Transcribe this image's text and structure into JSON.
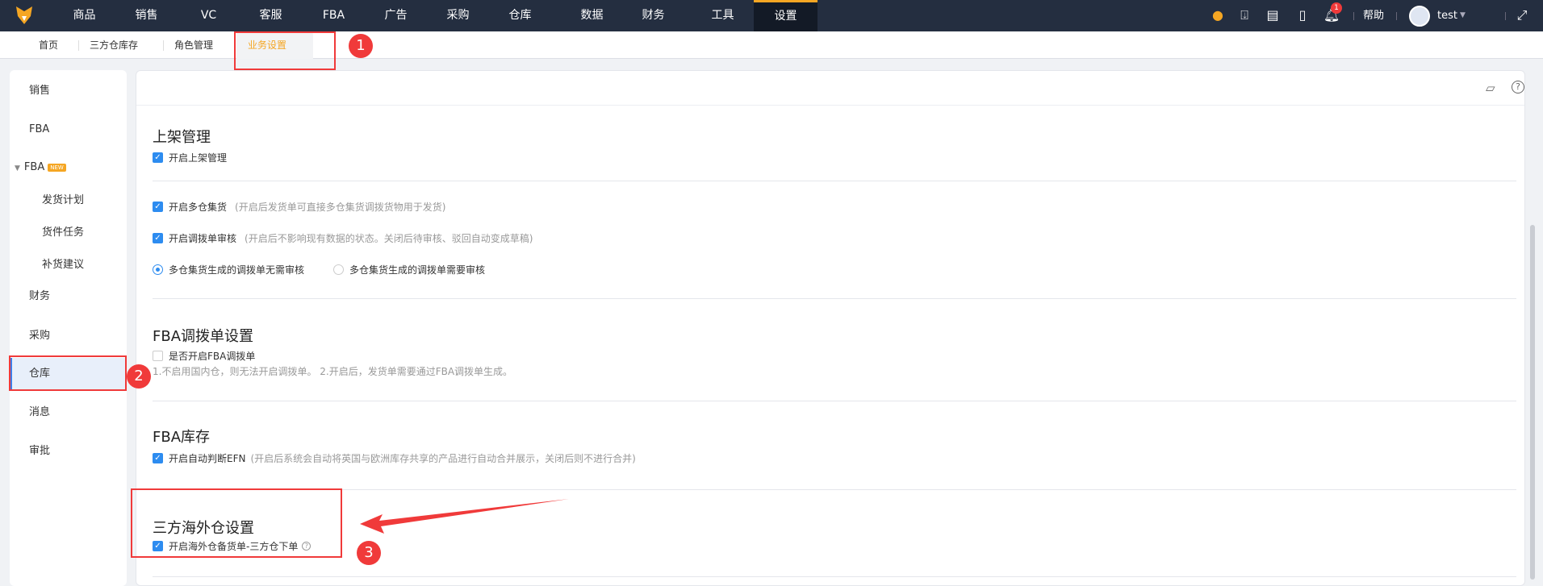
{
  "nav": {
    "items": [
      "商品",
      "销售",
      "VC",
      "客服",
      "FBA",
      "广告",
      "采购",
      "仓库",
      "数据",
      "财务",
      "工具",
      "设置"
    ],
    "active": "设置",
    "help": "帮助",
    "user": "test",
    "notification_count": "1"
  },
  "tabs": {
    "items": [
      "首页",
      "三方仓库存",
      "角色管理"
    ],
    "active": "业务设置",
    "close": "×"
  },
  "sidebar": {
    "items": [
      "销售",
      "FBA",
      "FBA",
      "发货计划",
      "货件任务",
      "补货建议",
      "财务",
      "采购",
      "仓库",
      "消息",
      "审批"
    ],
    "new_badge": "NEW"
  },
  "main": {
    "s1": {
      "title": "上架管理",
      "enable": "开启上架管理"
    },
    "s2": {
      "multi": "开启多仓集货",
      "multi_hint": "(开启后发货单可直接多仓集货调拨货物用于发货)",
      "audit": "开启调拨单审核",
      "audit_hint": "(开启后不影响现有数据的状态。关闭后待审核、驳回自动变成草稿)",
      "radio1": "多仓集货生成的调拨单无需审核",
      "radio2": "多仓集货生成的调拨单需要审核"
    },
    "s3": {
      "title": "FBA调拨单设置",
      "enable": "是否开启FBA调拨单",
      "note": "1.不启用国内仓，则无法开启调拨单。 2.开启后，发货单需要通过FBA调拨单生成。"
    },
    "s4": {
      "title": "FBA库存",
      "enable": "开启自动判断EFN",
      "hint": "(开启后系统会自动将英国与欧洲库存共享的产品进行自动合并展示，关闭后则不进行合并)"
    },
    "s5": {
      "title": "三方海外仓设置",
      "enable": "开启海外仓备货单-三方仓下单"
    }
  },
  "annotations": [
    "1",
    "2",
    "3"
  ],
  "colors": {
    "nav_bg": "#242e40",
    "accent": "#f5a623",
    "primary": "#2d8cf0",
    "annotation": "#f03a3a"
  }
}
